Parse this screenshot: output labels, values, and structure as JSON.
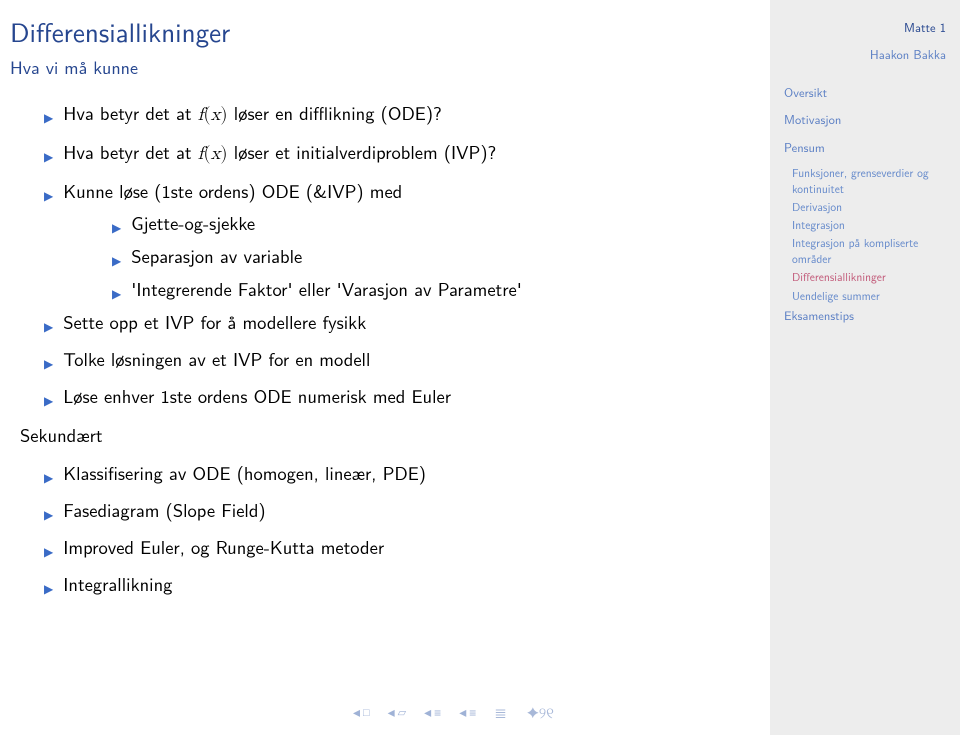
{
  "title": "Differensiallikninger",
  "subtitle": "Hva vi må kunne",
  "bullets": [
    {
      "html": "Hva betyr det at <span class='math-i'>f</span><span class='math'>(</span><span class='math-i'>x</span><span class='math'>)</span> løser en difflikning (ODE)?"
    },
    {
      "html": "Hva betyr det at <span class='math-i'>f</span><span class='math'>(</span><span class='math-i'>x</span><span class='math'>)</span> løser et initialverdiproblem (IVP)?"
    },
    {
      "html": "Kunne løse (1ste ordens) ODE (&IVP) med",
      "sub": [
        "Gjette-og-sjekke",
        "Separasjon av variable",
        "'Integrerende Faktor' eller 'Varasjon av Parametre'"
      ]
    },
    {
      "html": "Sette opp et IVP for å modellere fysikk"
    },
    {
      "html": "Tolke løsningen av et IVP for en modell"
    },
    {
      "html": "Løse enhver 1ste ordens ODE numerisk med Euler"
    }
  ],
  "secondary_label": "Sekundært",
  "secondary_bullets": [
    "Klassifisering av ODE (homogen, lineær, PDE)",
    "Fasediagram (Slope Field)",
    "Improved Euler, og Runge-Kutta metoder",
    "Integrallikning"
  ],
  "sidebar": {
    "course": "Matte 1",
    "author": "Haakon Bakka",
    "links": [
      {
        "label": "Oversikt",
        "type": "link"
      },
      {
        "label": "Motivasjon",
        "type": "link"
      },
      {
        "label": "Pensum",
        "type": "link",
        "sub": [
          {
            "label": "Funksjoner, grenseverdier og kontinuitet",
            "active": false
          },
          {
            "label": "Derivasjon",
            "active": false
          },
          {
            "label": "Integrasjon",
            "active": false
          },
          {
            "label": "Integrasjon på kompliserte områder",
            "active": false
          },
          {
            "label": "Differensiallikninger",
            "active": true
          },
          {
            "label": "Uendelige summer",
            "active": false
          }
        ]
      },
      {
        "label": "Eksamenstips",
        "type": "link"
      }
    ]
  }
}
